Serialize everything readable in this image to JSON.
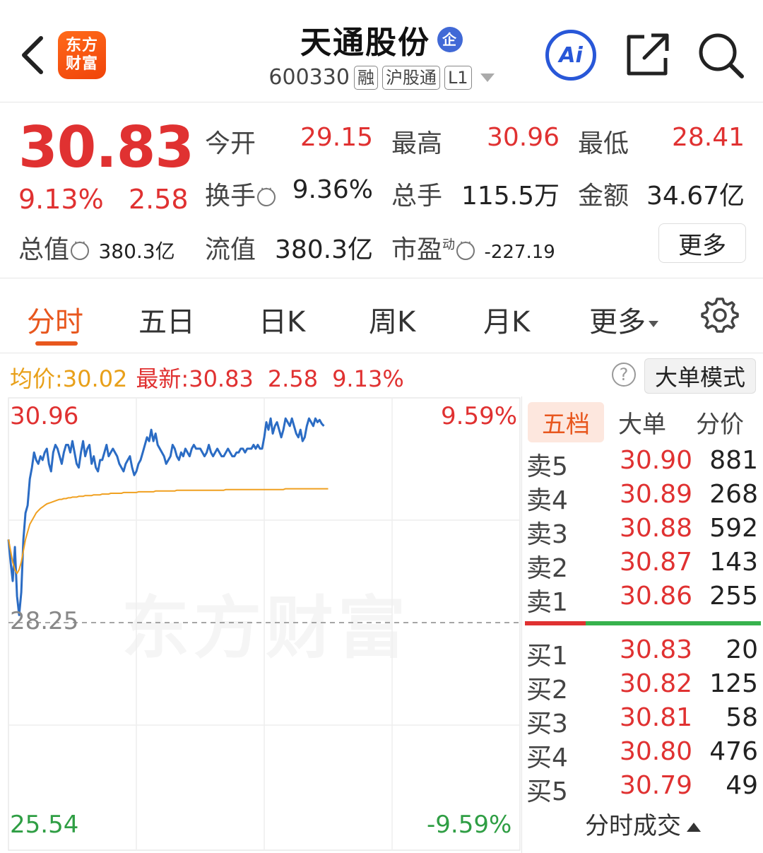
{
  "header": {
    "logo_line1": "东方",
    "logo_line2": "财富",
    "stock_name": "天通股份",
    "qi_badge": "企",
    "code": "600330",
    "tags": [
      "融",
      "沪股通",
      "L1"
    ],
    "ai_label": "Ai"
  },
  "quote": {
    "price": "30.83",
    "change_pct": "9.13%",
    "change_amt": "2.58",
    "open_label": "今开",
    "open_value": "29.15",
    "high_label": "最高",
    "high_value": "30.96",
    "low_label": "最低",
    "low_value": "28.41",
    "turnover_label": "换手",
    "turnover_value": "9.36%",
    "volume_label": "总手",
    "volume_value": "115.5万",
    "amount_label": "金额",
    "amount_value": "34.67亿",
    "mktcap_label": "总值",
    "mktcap_value": "380.3亿",
    "float_label": "流值",
    "float_value": "380.3亿",
    "pe_label": "市盈",
    "pe_sup": "动",
    "pe_value": "-227.19",
    "more_label": "更多"
  },
  "tabs": {
    "items": [
      "分时",
      "五日",
      "日K",
      "周K",
      "月K",
      "更多"
    ],
    "active": "分时"
  },
  "indicator": {
    "avg_label": "均价:",
    "avg_value": "30.02",
    "latest_label": "最新:",
    "latest_value": "30.83",
    "latest_chg": "2.58",
    "latest_pct": "9.13%",
    "help": "?",
    "mode_label": "大单模式"
  },
  "chart": {
    "y_top": "30.96",
    "y_mid": "28.25",
    "y_bottom": "25.54",
    "pct_top": "9.59%",
    "pct_bottom": "-9.59%",
    "watermark": "东方财富",
    "colors": {
      "price_line": "#2b6cc4",
      "avg_line": "#f0a020",
      "up": "#e03131",
      "down": "#2f9e44"
    }
  },
  "chart_data": {
    "type": "line",
    "ylim": [
      25.54,
      30.96
    ],
    "prev_close": 28.25,
    "series": [
      {
        "values": [
          29.35,
          29.05,
          28.8,
          29.25,
          28.6,
          28.35,
          28.65,
          29.35,
          29.7,
          29.8,
          30.15,
          30.3,
          30.5,
          30.4,
          30.35,
          30.45,
          30.4,
          30.5,
          30.55,
          30.35,
          30.25,
          30.5,
          30.6,
          30.55,
          30.45,
          30.35,
          30.5,
          30.6,
          30.6,
          30.5,
          30.65,
          30.5,
          30.35,
          30.3,
          30.5,
          30.65,
          30.45,
          30.55,
          30.6,
          30.35,
          30.45,
          30.3,
          30.25,
          30.4,
          30.4,
          30.5,
          30.6,
          30.45,
          30.5,
          30.55,
          30.5,
          30.45,
          30.35,
          30.3,
          30.25,
          30.35,
          30.4,
          30.45,
          30.3,
          30.2,
          30.25,
          30.35,
          30.4,
          30.5,
          30.6,
          30.7,
          30.65,
          30.8,
          30.65,
          30.75,
          30.6,
          30.55,
          30.5,
          30.45,
          30.35,
          30.4,
          30.45,
          30.6,
          30.55,
          30.45,
          30.4,
          30.5,
          30.45,
          30.55,
          30.5,
          30.45,
          30.55,
          30.6,
          30.55,
          30.55,
          30.55,
          30.5,
          30.45,
          30.5,
          30.6,
          30.5,
          30.45,
          30.5,
          30.55,
          30.5,
          30.45,
          30.45,
          30.5,
          30.55,
          30.5,
          30.45,
          30.45,
          30.5,
          30.5,
          30.55,
          30.55,
          30.5,
          30.55,
          30.55,
          30.55,
          30.6,
          30.55,
          30.6,
          30.55,
          30.55,
          30.7,
          30.9,
          30.8,
          30.95,
          30.75,
          30.85,
          30.9,
          30.8,
          30.7,
          30.8,
          30.95,
          30.9,
          30.85,
          30.95,
          30.85,
          30.75,
          30.7,
          30.8,
          30.65,
          30.7,
          30.85,
          30.95,
          30.9,
          30.85,
          30.95,
          30.9,
          30.93,
          30.88,
          30.85
        ]
      },
      {
        "values": [
          29.35,
          29.2,
          29.05,
          28.95,
          28.9,
          28.95,
          29.05,
          29.2,
          29.35,
          29.45,
          29.55,
          29.6,
          29.65,
          29.7,
          29.73,
          29.76,
          29.78,
          29.8,
          29.82,
          29.83,
          29.84,
          29.85,
          29.86,
          29.87,
          29.88,
          29.88,
          29.89,
          29.89,
          29.9,
          29.9,
          29.91,
          29.91,
          29.91,
          29.92,
          29.92,
          29.92,
          29.93,
          29.93,
          29.93,
          29.93,
          29.94,
          29.94,
          29.94,
          29.94,
          29.95,
          29.95,
          29.95,
          29.95,
          29.96,
          29.96,
          29.96,
          29.96,
          29.96,
          29.96,
          29.97,
          29.97,
          29.97,
          29.97,
          29.97,
          29.97,
          29.97,
          29.98,
          29.98,
          29.98,
          29.98,
          29.98,
          29.98,
          29.98,
          29.98,
          29.99,
          29.99,
          29.99,
          29.99,
          29.99,
          29.99,
          29.99,
          29.99,
          29.99,
          29.99,
          30.0,
          30.0,
          30.0,
          30.0,
          30.0,
          30.0,
          30.0,
          30.0,
          30.0,
          30.0,
          30.0,
          30.0,
          30.0,
          30.0,
          30.0,
          30.0,
          30.0,
          30.0,
          30.0,
          30.0,
          30.0,
          30.0,
          30.0,
          30.01,
          30.01,
          30.01,
          30.01,
          30.01,
          30.01,
          30.01,
          30.01,
          30.01,
          30.01,
          30.01,
          30.01,
          30.01,
          30.01,
          30.01,
          30.01,
          30.01,
          30.01,
          30.01,
          30.01,
          30.01,
          30.01,
          30.01,
          30.01,
          30.01,
          30.01,
          30.01,
          30.01,
          30.02,
          30.02,
          30.02,
          30.02,
          30.02,
          30.02,
          30.02,
          30.02,
          30.02,
          30.02,
          30.02,
          30.02,
          30.02,
          30.02,
          30.02,
          30.02,
          30.02,
          30.02,
          30.02,
          30.02,
          30.02
        ]
      }
    ]
  },
  "book": {
    "tabs": [
      "五档",
      "大单",
      "分价"
    ],
    "asks": [
      {
        "label": "卖5",
        "price": "30.90",
        "vol": "881"
      },
      {
        "label": "卖4",
        "price": "30.89",
        "vol": "268"
      },
      {
        "label": "卖3",
        "price": "30.88",
        "vol": "592"
      },
      {
        "label": "卖2",
        "price": "30.87",
        "vol": "143"
      },
      {
        "label": "卖1",
        "price": "30.86",
        "vol": "255"
      }
    ],
    "bids": [
      {
        "label": "买1",
        "price": "30.83",
        "vol": "20"
      },
      {
        "label": "买2",
        "price": "30.82",
        "vol": "125"
      },
      {
        "label": "买3",
        "price": "30.81",
        "vol": "58"
      },
      {
        "label": "买4",
        "price": "30.80",
        "vol": "476"
      },
      {
        "label": "买5",
        "price": "30.79",
        "vol": "49"
      }
    ],
    "footer": "分时成交"
  }
}
